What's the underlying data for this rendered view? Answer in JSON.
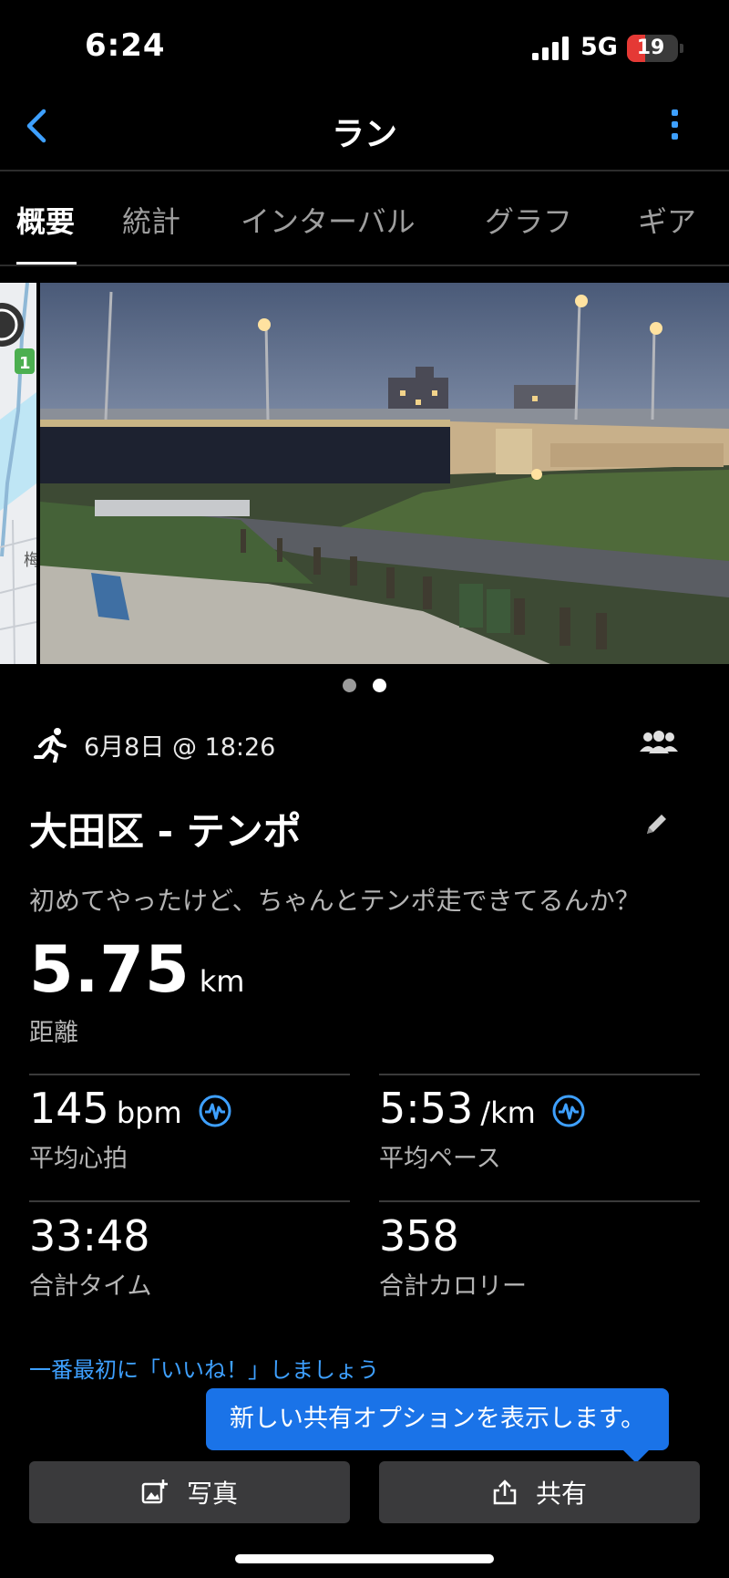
{
  "status_bar": {
    "time": "6:24",
    "network": "5G",
    "battery": "19",
    "battery_color": "#e53935"
  },
  "nav": {
    "title": "ラン",
    "back_icon": "chevron-left-icon",
    "menu_icon": "kebab-menu-icon",
    "accent": "#3ea0ff"
  },
  "tabs": [
    {
      "label": "概要",
      "active": true
    },
    {
      "label": "統計",
      "active": false
    },
    {
      "label": "インターバル",
      "active": false
    },
    {
      "label": "グラフ",
      "active": false
    },
    {
      "label": "ギア",
      "active": false
    }
  ],
  "carousel": {
    "pages": 2,
    "current": 2
  },
  "activity": {
    "date": "6月8日 @ 18:26",
    "title": "大田区 - テンポ",
    "description": "初めてやったけど、ちゃんとテンポ走できてるんか？",
    "distance": {
      "value": "5.75",
      "unit": "km",
      "label": "距離"
    }
  },
  "stats": [
    {
      "value": "145",
      "unit": "bpm",
      "label": "平均心拍",
      "icon": "heart-rate-icon"
    },
    {
      "value": "5:53",
      "unit": "/km",
      "label": "平均ペース",
      "icon": "heart-rate-icon"
    },
    {
      "value": "33:48",
      "unit": "",
      "label": "合計タイム"
    },
    {
      "value": "358",
      "unit": "",
      "label": "合計カロリー"
    }
  ],
  "like_prompt": "一番最初に「いいね！」しましょう",
  "tooltip": "新しい共有オプションを表示します。",
  "buttons": {
    "photo": "写真",
    "share": "共有"
  }
}
